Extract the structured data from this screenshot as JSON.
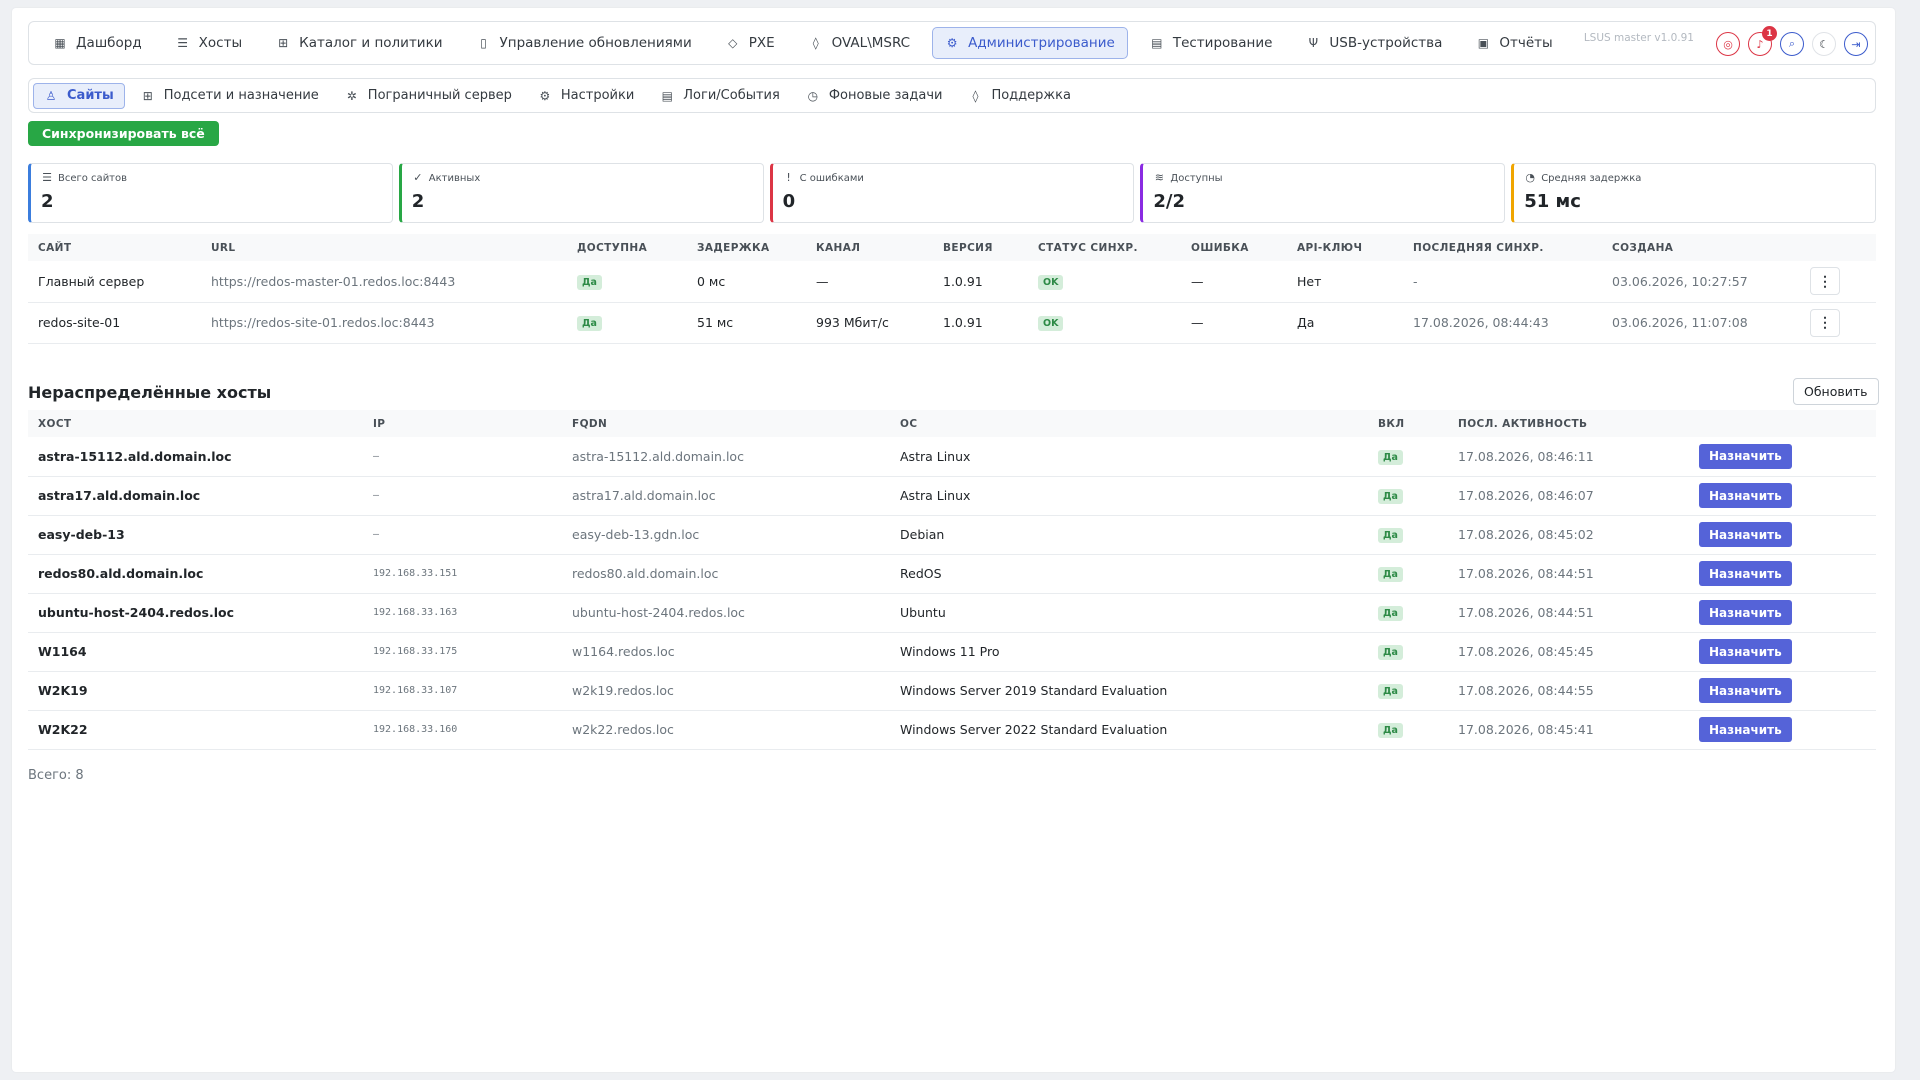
{
  "topnav": {
    "items": [
      {
        "label": "Дашборд",
        "icon": "dashboard-icon"
      },
      {
        "label": "Хосты",
        "icon": "server-icon"
      },
      {
        "label": "Каталог и политики",
        "icon": "catalog-icon"
      },
      {
        "label": "Управление обновлениями",
        "icon": "update-icon"
      },
      {
        "label": "PXE",
        "icon": "box-icon"
      },
      {
        "label": "OVAL\\MSRC",
        "icon": "shield-icon"
      },
      {
        "label": "Администрирование",
        "icon": "admin-icon"
      },
      {
        "label": "Тестирование",
        "icon": "test-icon"
      },
      {
        "label": "USB-устройства",
        "icon": "usb-icon"
      },
      {
        "label": "Отчёты",
        "icon": "report-icon"
      }
    ],
    "version": "LSUS master v1.0.91",
    "notifications_count": "1"
  },
  "subnav": {
    "items": [
      {
        "label": "Сайты",
        "icon": "sites-icon"
      },
      {
        "label": "Подсети и назначение",
        "icon": "subnet-icon"
      },
      {
        "label": "Пограничный сервер",
        "icon": "edge-server-icon"
      },
      {
        "label": "Настройки",
        "icon": "settings-icon"
      },
      {
        "label": "Логи/События",
        "icon": "logs-icon"
      },
      {
        "label": "Фоновые задачи",
        "icon": "clock-icon"
      },
      {
        "label": "Поддержка",
        "icon": "support-icon"
      }
    ]
  },
  "sync_all_label": "Синхронизировать всё",
  "stats": [
    {
      "label": "Всего сайтов",
      "value": "2",
      "color": "#3b7ddd",
      "icon": "server-icon"
    },
    {
      "label": "Активных",
      "value": "2",
      "color": "#28a745",
      "icon": "check-circle-icon"
    },
    {
      "label": "С ошибками",
      "value": "0",
      "color": "#dc3545",
      "icon": "alert-circle-icon"
    },
    {
      "label": "Доступны",
      "value": "2/2",
      "color": "#8a2be2",
      "icon": "signal-icon"
    },
    {
      "label": "Средняя задержка",
      "value": "51 мс",
      "color": "#f0a500",
      "icon": "gauge-icon"
    }
  ],
  "sites_table": {
    "headers": [
      "САЙТ",
      "URL",
      "ДОСТУПНА",
      "ЗАДЕРЖКА",
      "КАНАЛ",
      "ВЕРСИЯ",
      "СТАТУС СИНХР.",
      "ОШИБКА",
      "API-КЛЮЧ",
      "ПОСЛЕДНЯЯ СИНХР.",
      "СОЗДАНА"
    ],
    "rows": [
      {
        "site": "Главный сервер",
        "url": "https://redos-master-01.redos.loc:8443",
        "available": "Да",
        "latency": "0 мс",
        "channel": "—",
        "version": "1.0.91",
        "sync_status": "OK",
        "error": "—",
        "api_key": "Нет",
        "last_sync": "-",
        "created": "03.06.2026, 10:27:57"
      },
      {
        "site": "redos-site-01",
        "url": "https://redos-site-01.redos.loc:8443",
        "available": "Да",
        "latency": "51 мс",
        "channel": "993 Мбит/с",
        "version": "1.0.91",
        "sync_status": "OK",
        "error": "—",
        "api_key": "Да",
        "last_sync": "17.08.2026, 08:44:43",
        "created": "03.06.2026, 11:07:08"
      }
    ],
    "menu_glyph": "⋮"
  },
  "unassigned": {
    "title": "Нераспределённые хосты",
    "refresh_label": "Обновить",
    "headers": [
      "ХОСТ",
      "IP",
      "FQDN",
      "ОС",
      "ВКЛ",
      "ПОСЛ. АКТИВНОСТЬ"
    ],
    "assign_label": "Назначить",
    "rows": [
      {
        "host": "astra-15112.ald.domain.loc",
        "ip": "–",
        "fqdn": "astra-15112.ald.domain.loc",
        "os": "Astra Linux",
        "enabled": "Да",
        "last_activity": "17.08.2026, 08:46:11"
      },
      {
        "host": "astra17.ald.domain.loc",
        "ip": "–",
        "fqdn": "astra17.ald.domain.loc",
        "os": "Astra Linux",
        "enabled": "Да",
        "last_activity": "17.08.2026, 08:46:07"
      },
      {
        "host": "easy-deb-13",
        "ip": "–",
        "fqdn": "easy-deb-13.gdn.loc",
        "os": "Debian",
        "enabled": "Да",
        "last_activity": "17.08.2026, 08:45:02"
      },
      {
        "host": "redos80.ald.domain.loc",
        "ip": "192.168.33.151",
        "fqdn": "redos80.ald.domain.loc",
        "os": "RedOS",
        "enabled": "Да",
        "last_activity": "17.08.2026, 08:44:51"
      },
      {
        "host": "ubuntu-host-2404.redos.loc",
        "ip": "192.168.33.163",
        "fqdn": "ubuntu-host-2404.redos.loc",
        "os": "Ubuntu",
        "enabled": "Да",
        "last_activity": "17.08.2026, 08:44:51"
      },
      {
        "host": "W1164",
        "ip": "192.168.33.175",
        "fqdn": "w1164.redos.loc",
        "os": "Windows 11 Pro",
        "enabled": "Да",
        "last_activity": "17.08.2026, 08:45:45"
      },
      {
        "host": "W2K19",
        "ip": "192.168.33.107",
        "fqdn": "w2k19.redos.loc",
        "os": "Windows Server 2019 Standard Evaluation",
        "enabled": "Да",
        "last_activity": "17.08.2026, 08:44:55"
      },
      {
        "host": "W2K22",
        "ip": "192.168.33.160",
        "fqdn": "w2k22.redos.loc",
        "os": "Windows Server 2022 Standard Evaluation",
        "enabled": "Да",
        "last_activity": "17.08.2026, 08:45:41"
      }
    ],
    "total": "Всего: 8"
  }
}
